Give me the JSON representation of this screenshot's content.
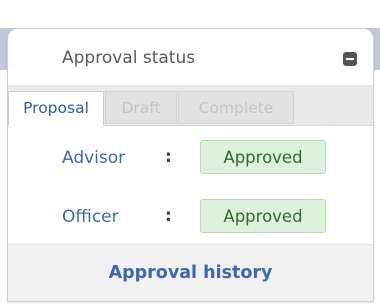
{
  "panel": {
    "title": "Approval status",
    "collapse_icon": "minus-icon"
  },
  "tabs": [
    {
      "label": "Proposal",
      "active": true
    },
    {
      "label": "Draft",
      "active": false
    },
    {
      "label": "Complete",
      "active": false
    }
  ],
  "approvals": [
    {
      "role": "Advisor",
      "separator": ":",
      "status": "Approved"
    },
    {
      "role": "Officer",
      "separator": ":",
      "status": "Approved"
    }
  ],
  "footer": {
    "link_label": "Approval history"
  },
  "colors": {
    "accent": "#3d67b0",
    "approved_bg": "#ddf1dd",
    "approved_text": "#2f6b2f"
  }
}
